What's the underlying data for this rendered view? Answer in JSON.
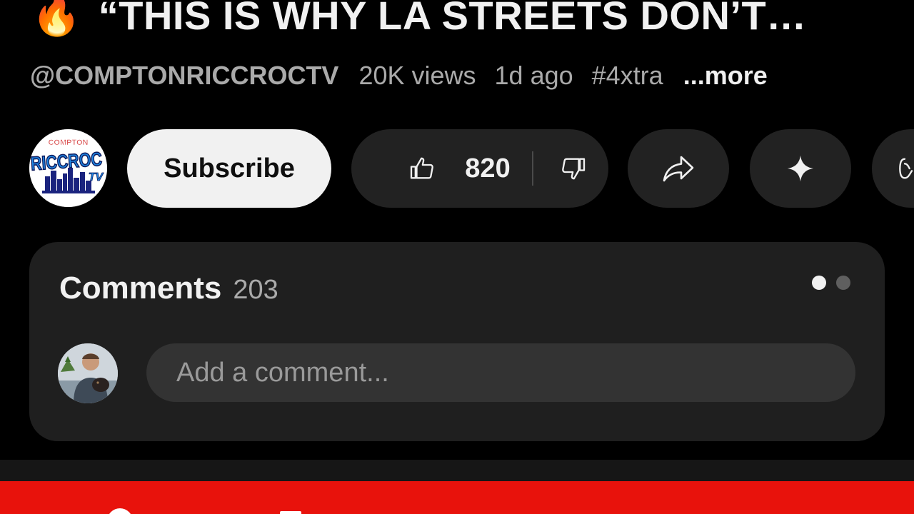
{
  "video": {
    "title_emoji": "🔥",
    "title": "“THIS IS WHY LA STREETS DON’T…",
    "channel_handle": "@COMPTONRICCROCTV",
    "views": "20K views",
    "uploaded": "1d ago",
    "hashtag": "#4xtra",
    "more_label": "...more"
  },
  "channel_logo": {
    "top_text": "COMPTON",
    "main_text": "RICCROC",
    "suffix_text": "TV"
  },
  "actions": {
    "subscribe_label": "Subscribe",
    "like_count": "820",
    "icons": {
      "like": "thumbs-up-icon",
      "dislike": "thumbs-down-icon",
      "share": "share-icon",
      "remix": "sparkle-icon",
      "more": "remix-icon"
    }
  },
  "comments": {
    "label": "Comments",
    "count": "203",
    "input_placeholder": "Add a comment...",
    "pager": {
      "total": 2,
      "active_index": 0
    }
  },
  "colors": {
    "background": "#000000",
    "card": "#1f1f1f",
    "pill": "#222222",
    "subscribe_bg": "#f1f1f1",
    "accent_red": "#e8120c"
  }
}
